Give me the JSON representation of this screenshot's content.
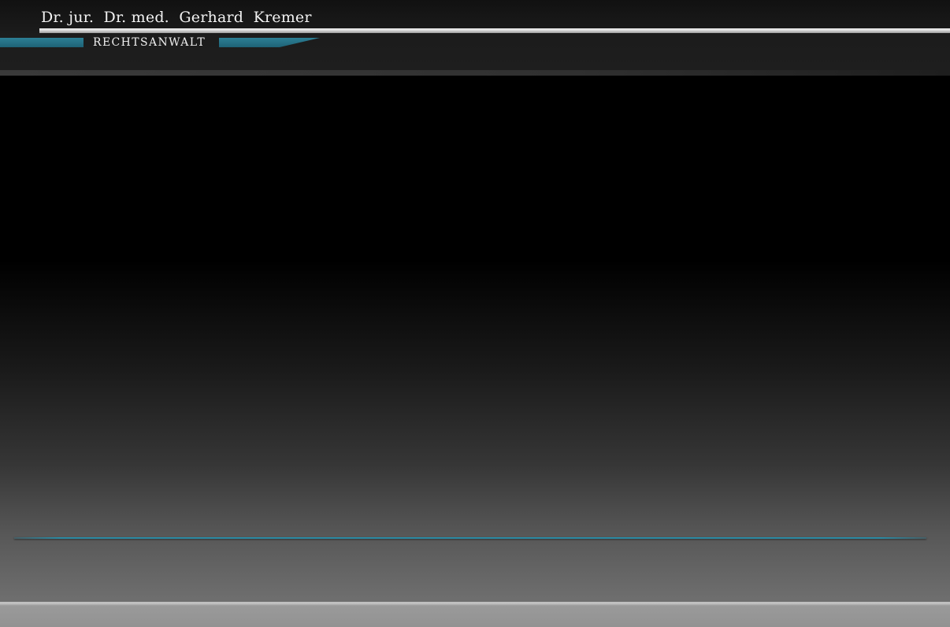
{
  "header": {
    "site_name": "Dr. jur.  Dr. med.  Gerhard  Kremer",
    "subtitle": "RECHTSANWALT"
  },
  "colors": {
    "accent_teal": "#1e6276",
    "rule_silver": "#d8d8d8",
    "background": "#000000"
  }
}
